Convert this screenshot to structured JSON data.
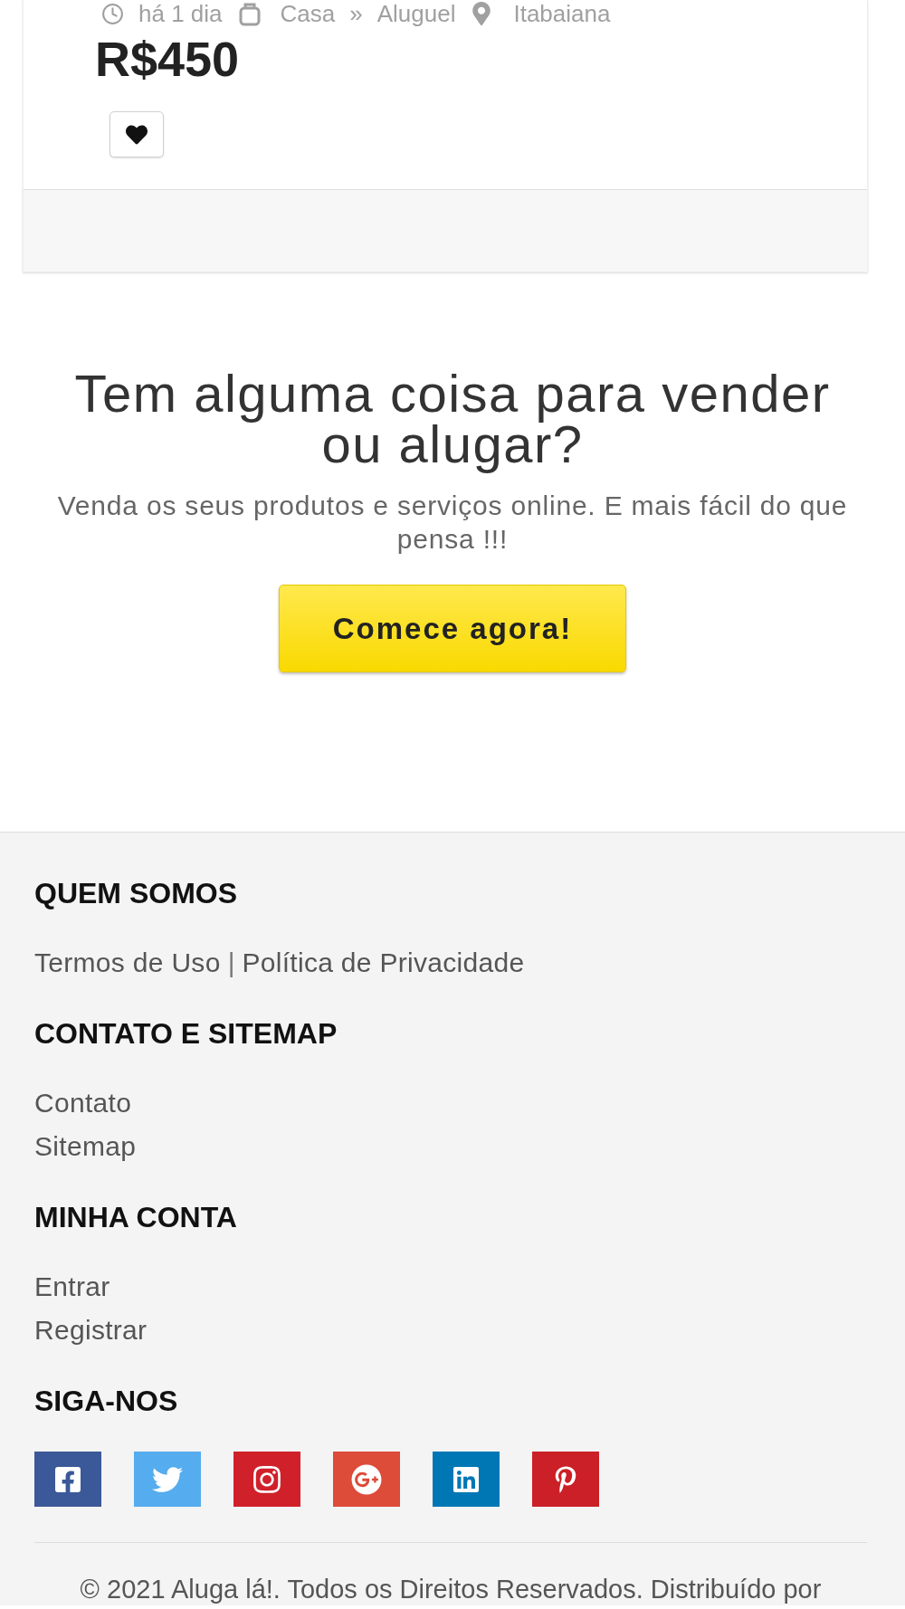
{
  "listing": {
    "posted": "há 1 dia",
    "category": "Casa",
    "separator": "»",
    "subcategory": "Aluguel",
    "location": "Itabaiana",
    "price": "R$450"
  },
  "cta": {
    "title": "Tem alguma coisa para vender ou alugar?",
    "text": "Venda os seus produtos e serviços online. E mais fácil do que pensa !!!",
    "button": "Comece agora!"
  },
  "footer": {
    "sections": [
      {
        "title": "QUEM SOMOS",
        "kind": "inline",
        "separator": "|",
        "links": [
          "Termos de Uso",
          "Política de Privacidade"
        ]
      },
      {
        "title": "CONTATO E SITEMAP",
        "kind": "stacked",
        "links": [
          "Contato",
          "Sitemap"
        ]
      },
      {
        "title": "MINHA CONTA",
        "kind": "stacked",
        "links": [
          "Entrar",
          "Registrar"
        ]
      }
    ],
    "follow": {
      "title": "SIGA-NOS",
      "networks": [
        {
          "kind": "facebook",
          "color": "#3b5998"
        },
        {
          "kind": "twitter",
          "color": "#55acee"
        },
        {
          "kind": "instagram",
          "color": "#d0212a"
        },
        {
          "kind": "google-plus",
          "color": "#dd4b39"
        },
        {
          "kind": "linkedin",
          "color": "#0077b5"
        },
        {
          "kind": "pinterest",
          "color": "#cb2027"
        }
      ]
    },
    "copyright": "© 2021 Aluga lá!. Todos os Direitos Reservados. Distribuído por"
  }
}
